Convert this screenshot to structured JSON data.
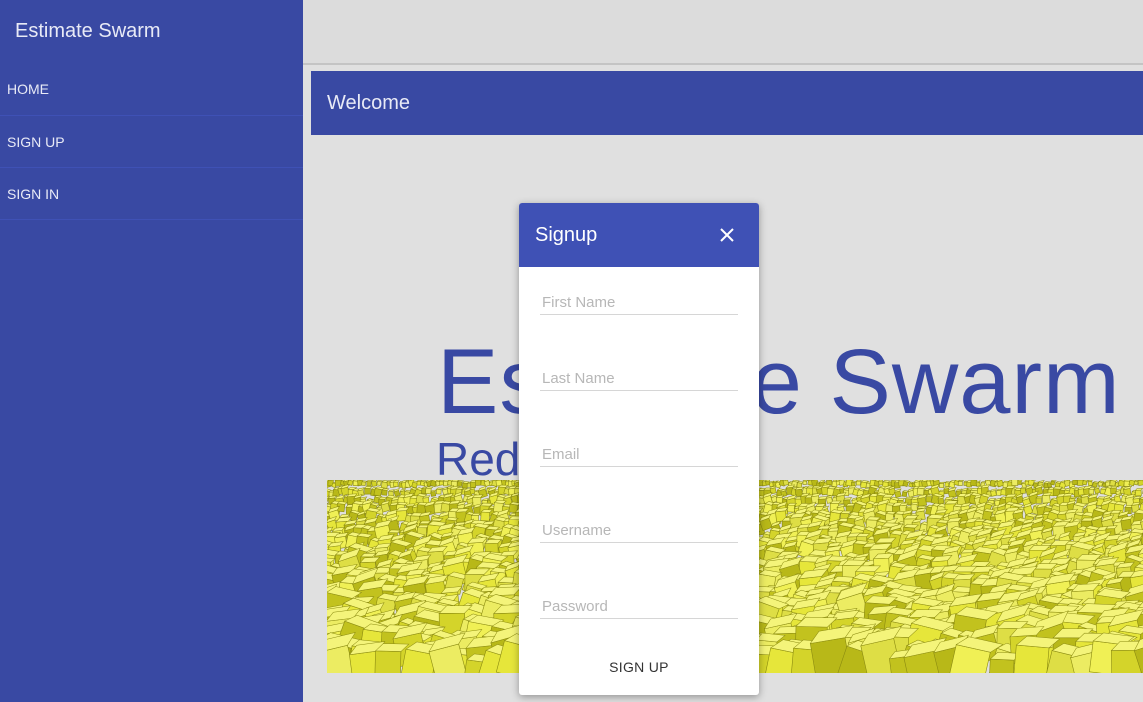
{
  "sidebar": {
    "app_title": "Estimate Swarm",
    "items": [
      {
        "label": "HOME"
      },
      {
        "label": "SIGN UP"
      },
      {
        "label": "SIGN IN"
      }
    ]
  },
  "main": {
    "header_title": "Welcome",
    "hero_title": "Estimate Swarm",
    "hero_subtitle": "Red mates"
  },
  "dialog": {
    "title": "Signup",
    "close_icon": "close-icon",
    "fields": {
      "first_name": {
        "placeholder": "First Name",
        "value": ""
      },
      "last_name": {
        "placeholder": "Last Name",
        "value": ""
      },
      "email": {
        "placeholder": "Email",
        "value": ""
      },
      "username": {
        "placeholder": "Username",
        "value": ""
      },
      "password": {
        "placeholder": "Password",
        "value": ""
      }
    },
    "submit_label": "SIGN UP"
  },
  "colors": {
    "primary": "#3949a3",
    "dialog_header": "#3f51b5",
    "background": "#e0e0e0",
    "cube_yellow": "#d8d828"
  }
}
